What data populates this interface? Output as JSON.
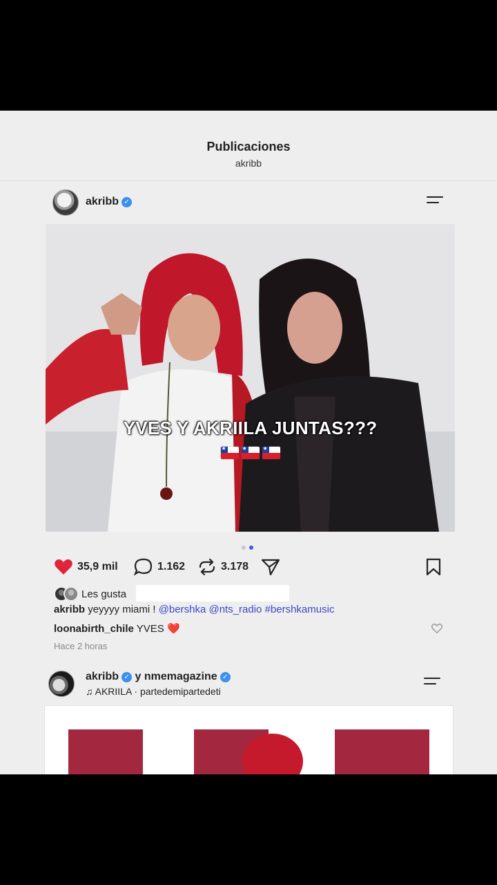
{
  "header": {
    "title": "Publicaciones",
    "subtitle": "akribb"
  },
  "post1": {
    "username": "akribb",
    "overlay_text": "YVES Y AKRIILA  JUNTAS???",
    "likes": "35,9 mil",
    "comments": "1.162",
    "reposts": "3.178",
    "liked_by_prefix": "Les gusta",
    "caption": {
      "user": "akribb",
      "text": "yeyyyy miami !",
      "mentions": "@bershka @nts_radio #bershkamusic"
    },
    "comment": {
      "user": "loonabirth_chile",
      "text": "YVES ❤️"
    },
    "time": "Hace 2 horas"
  },
  "post2": {
    "username": "akribb",
    "collab_prefix": "y",
    "collab_user": "nmemagazine",
    "music": "AKRIILA · partedemipartedeti"
  },
  "colors": {
    "background": "#eeeeef",
    "accent_blue": "#3b47c4",
    "like_red": "#e0243a",
    "verified_blue": "#3b8ff0"
  },
  "icons": {
    "menu": "menu-lines-icon",
    "like": "heart-filled-icon",
    "comment": "comment-bubble-icon",
    "repost": "repost-icon",
    "share": "send-icon",
    "save": "bookmark-icon",
    "music": "music-note-icon"
  }
}
